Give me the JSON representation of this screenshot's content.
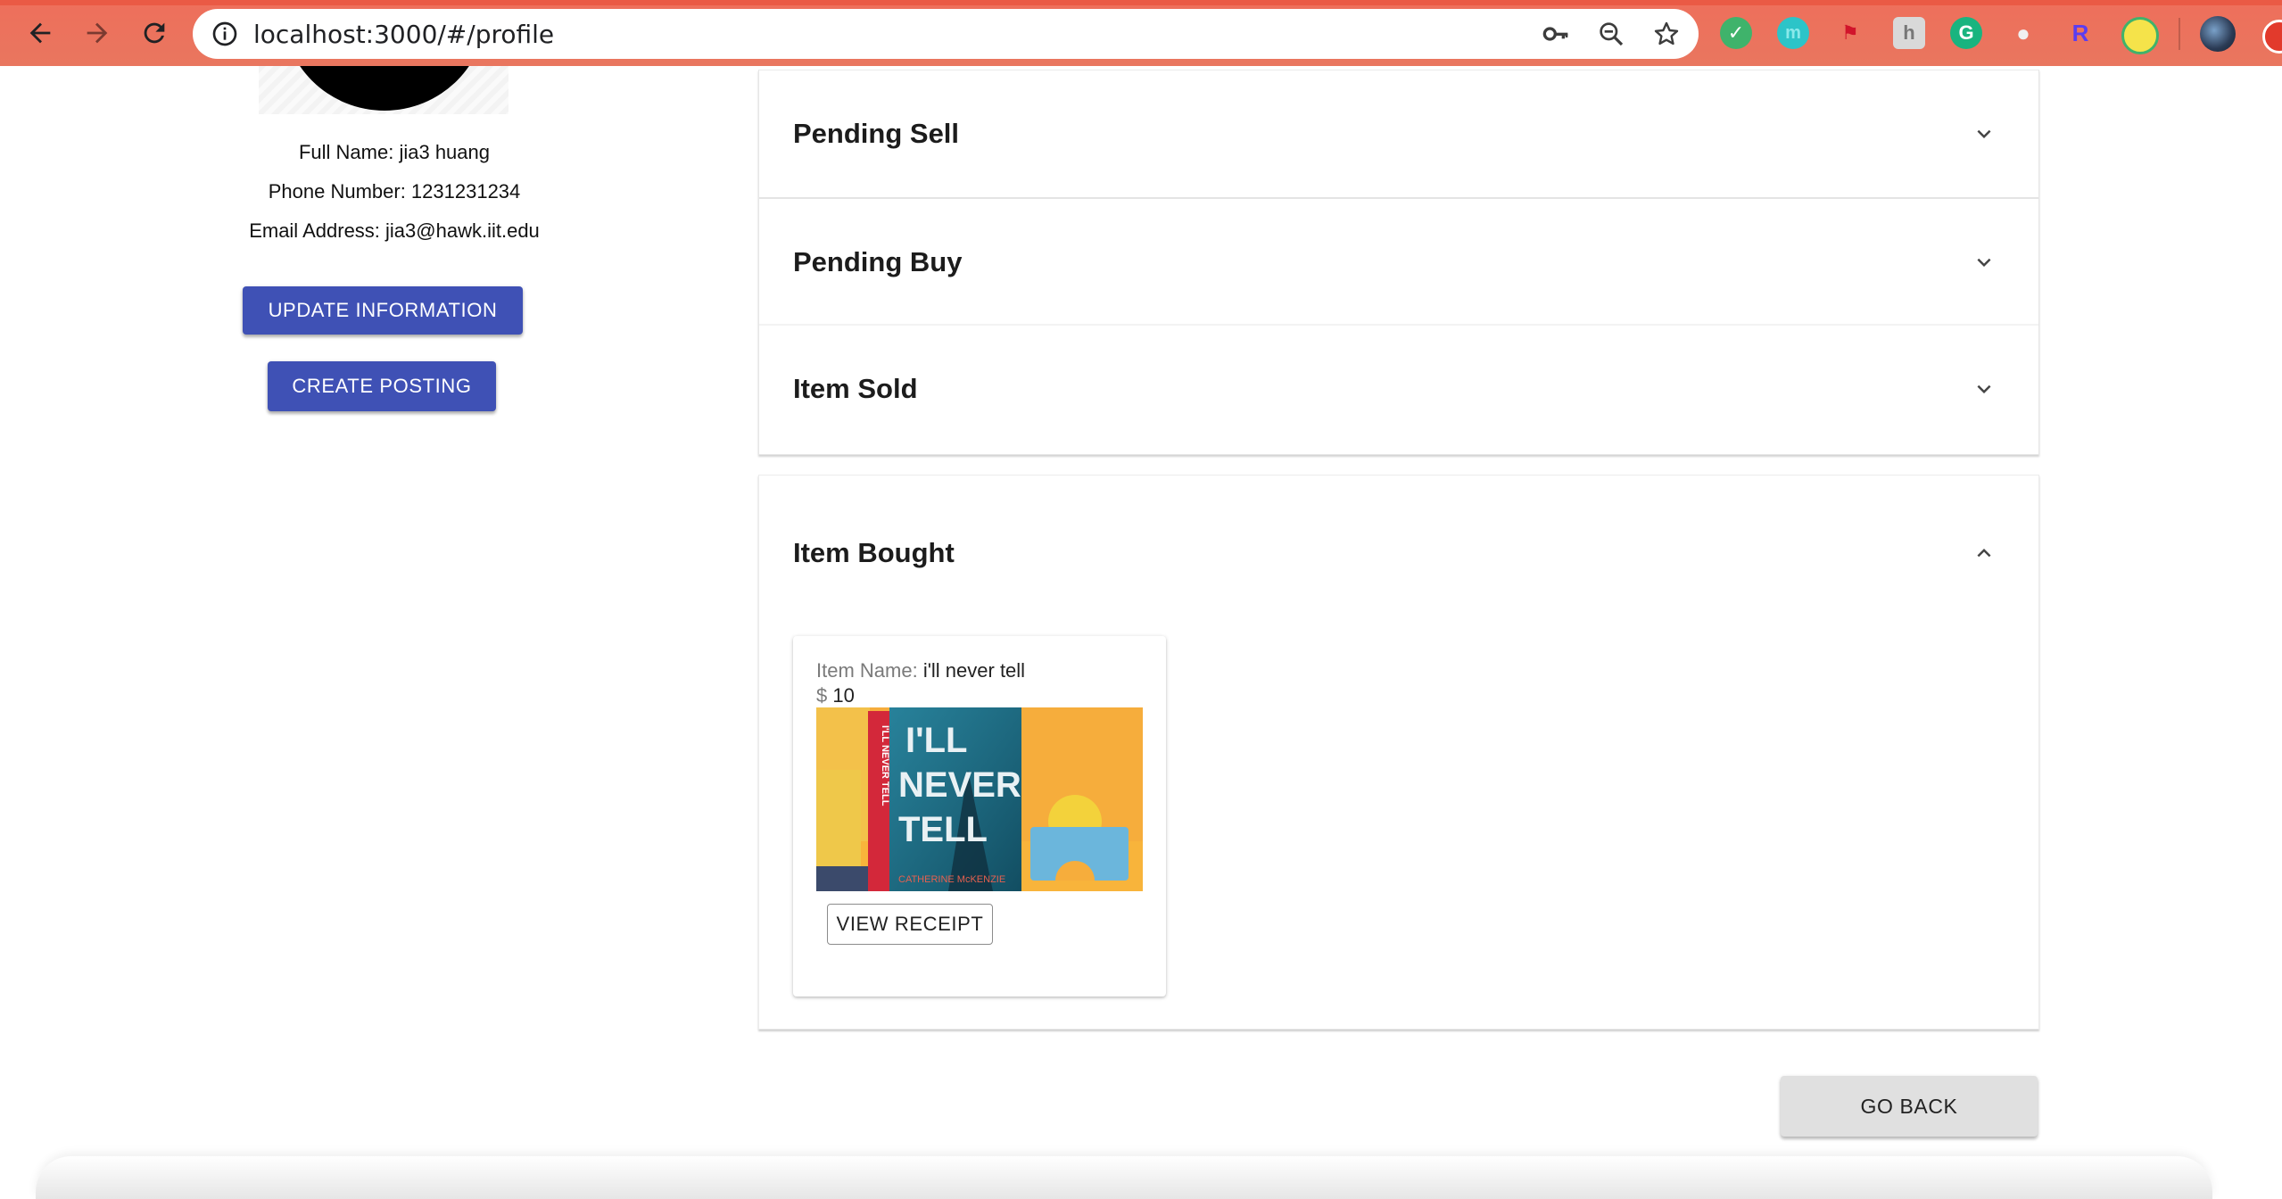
{
  "browser": {
    "url": "localhost:3000/#/profile"
  },
  "profile": {
    "full_name_line": "Full Name: jia3 huang",
    "phone_line": "Phone Number: 1231231234",
    "email_line": "Email Address: jia3@hawk.iit.edu",
    "update_button": "UPDATE INFORMATION",
    "create_button": "CREATE POSTING"
  },
  "accordions": {
    "pending_sell": "Pending Sell",
    "pending_buy": "Pending Buy",
    "item_sold": "Item Sold",
    "item_bought": "Item Bought"
  },
  "bought_item": {
    "name_label": "Item Name:",
    "name_value": "i'll never tell",
    "currency": "$",
    "price": "10",
    "receipt_button": "VIEW RECEIPT",
    "cover": {
      "title_line1": "I'LL",
      "title_line2": "NEVER",
      "title_line3": "TELL",
      "author": "CATHERINE McKENZIE",
      "spine": "I'LL NEVER TELL"
    }
  },
  "go_back_button": "GO BACK",
  "colors": {
    "primary": "#3f51b5",
    "chrome": "#ee6f5b"
  }
}
